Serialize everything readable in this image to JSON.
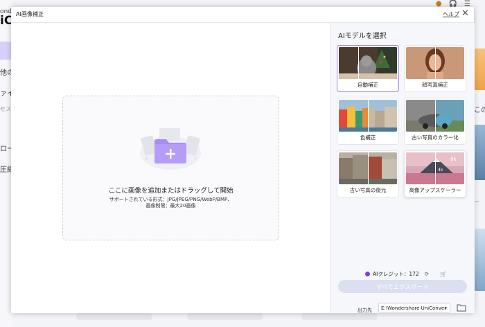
{
  "background": {
    "brand_top": "ondershare",
    "brand": "iC",
    "sidebar_items": [
      "他の",
      "ァイル",
      "セス",
      "ロー",
      "圧縮"
    ],
    "right_texts": [
      "この他",
      "ー"
    ]
  },
  "dialog": {
    "title": "AI画像補正",
    "help": "ヘルプ",
    "close": "✕"
  },
  "dropzone": {
    "title": "ここに画像を追加またはドラッグして開始",
    "formats": "サポートされている形式：JPG/JPEG/PNG/WebP/BMP、",
    "limit": "画像制限：最大20画像"
  },
  "panel": {
    "title": "AIモデルを選択",
    "models": [
      {
        "label": "自動補正",
        "selected": true
      },
      {
        "label": "顔写真補正",
        "selected": false
      },
      {
        "label": "色補正",
        "selected": false
      },
      {
        "label": "古い写真のカラー化",
        "selected": false
      },
      {
        "label": "古い写真の復元",
        "selected": false
      },
      {
        "label": "高像アップスケーラー",
        "selected": false,
        "badge_left": "4k",
        "badge_right": "8k"
      }
    ],
    "credit_label": "AIクレジット：172",
    "export_label": "すべてエクスポート",
    "output_label": "出力先",
    "output_path": "E:\\Wondershare UniConver"
  },
  "colors": {
    "accent": "#9b82f5",
    "credit": "#7a3cf0",
    "export_disabled": "#dcdff0"
  }
}
